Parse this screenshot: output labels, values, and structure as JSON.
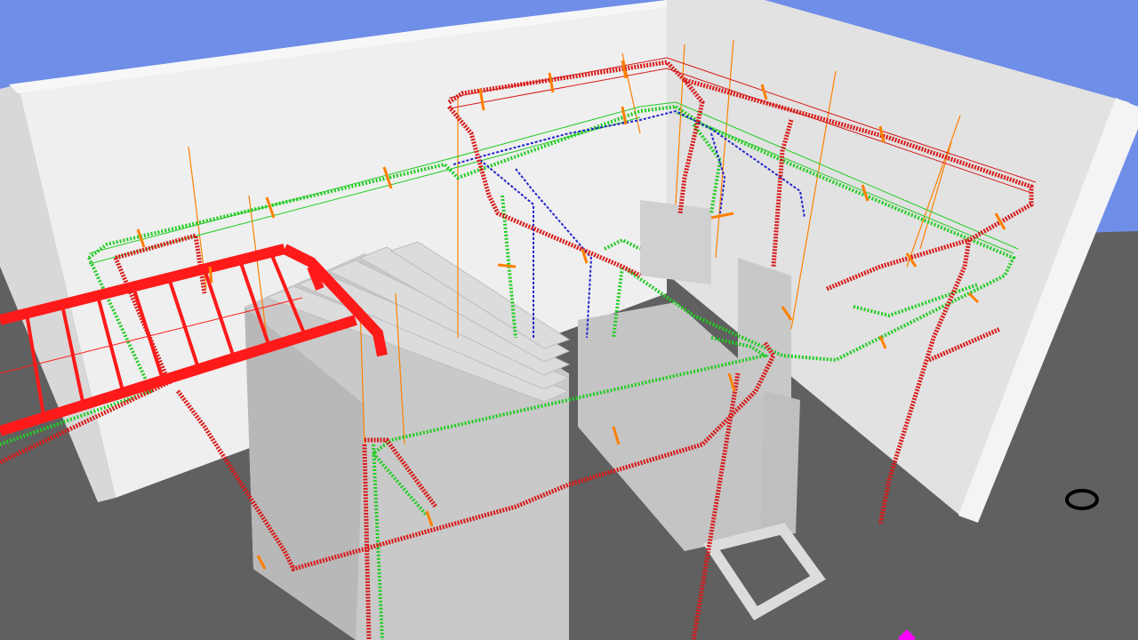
{
  "viewport": {
    "background": "#6f8ee8",
    "colors": {
      "floor": "#606060",
      "wall": "#ededed",
      "wall_dark": "#dcdcdc",
      "wall_edge": "#bdbdbd",
      "equipment": "#c9c9c9",
      "equipment_dark": "#b4b4b4",
      "red_tray": "#ff1a1a",
      "red_mesh": "#d81a1a",
      "green_mesh": "#22cc22",
      "blue_mesh": "#2222cc",
      "hanger": "#ff8000",
      "marker": "#ff00ff",
      "ring": "#000000"
    }
  },
  "scene": {
    "floor": "floor-plane",
    "walls": [
      "back-wall",
      "right-wall",
      "left-wall-edge"
    ],
    "equipment": [
      "electrical-cabinet-left",
      "cabinet-pillar-middle",
      "cabinet-pillar-right",
      "floor-frame"
    ],
    "cable_trays": [
      "red-ladder-tray",
      "red-wire-tray-network",
      "green-wire-tray-network",
      "blue-wire-tray-network"
    ],
    "supports": "hanger-rods-orange",
    "markers": [
      "pipe-ring-icon",
      "origin-marker-icon"
    ]
  }
}
